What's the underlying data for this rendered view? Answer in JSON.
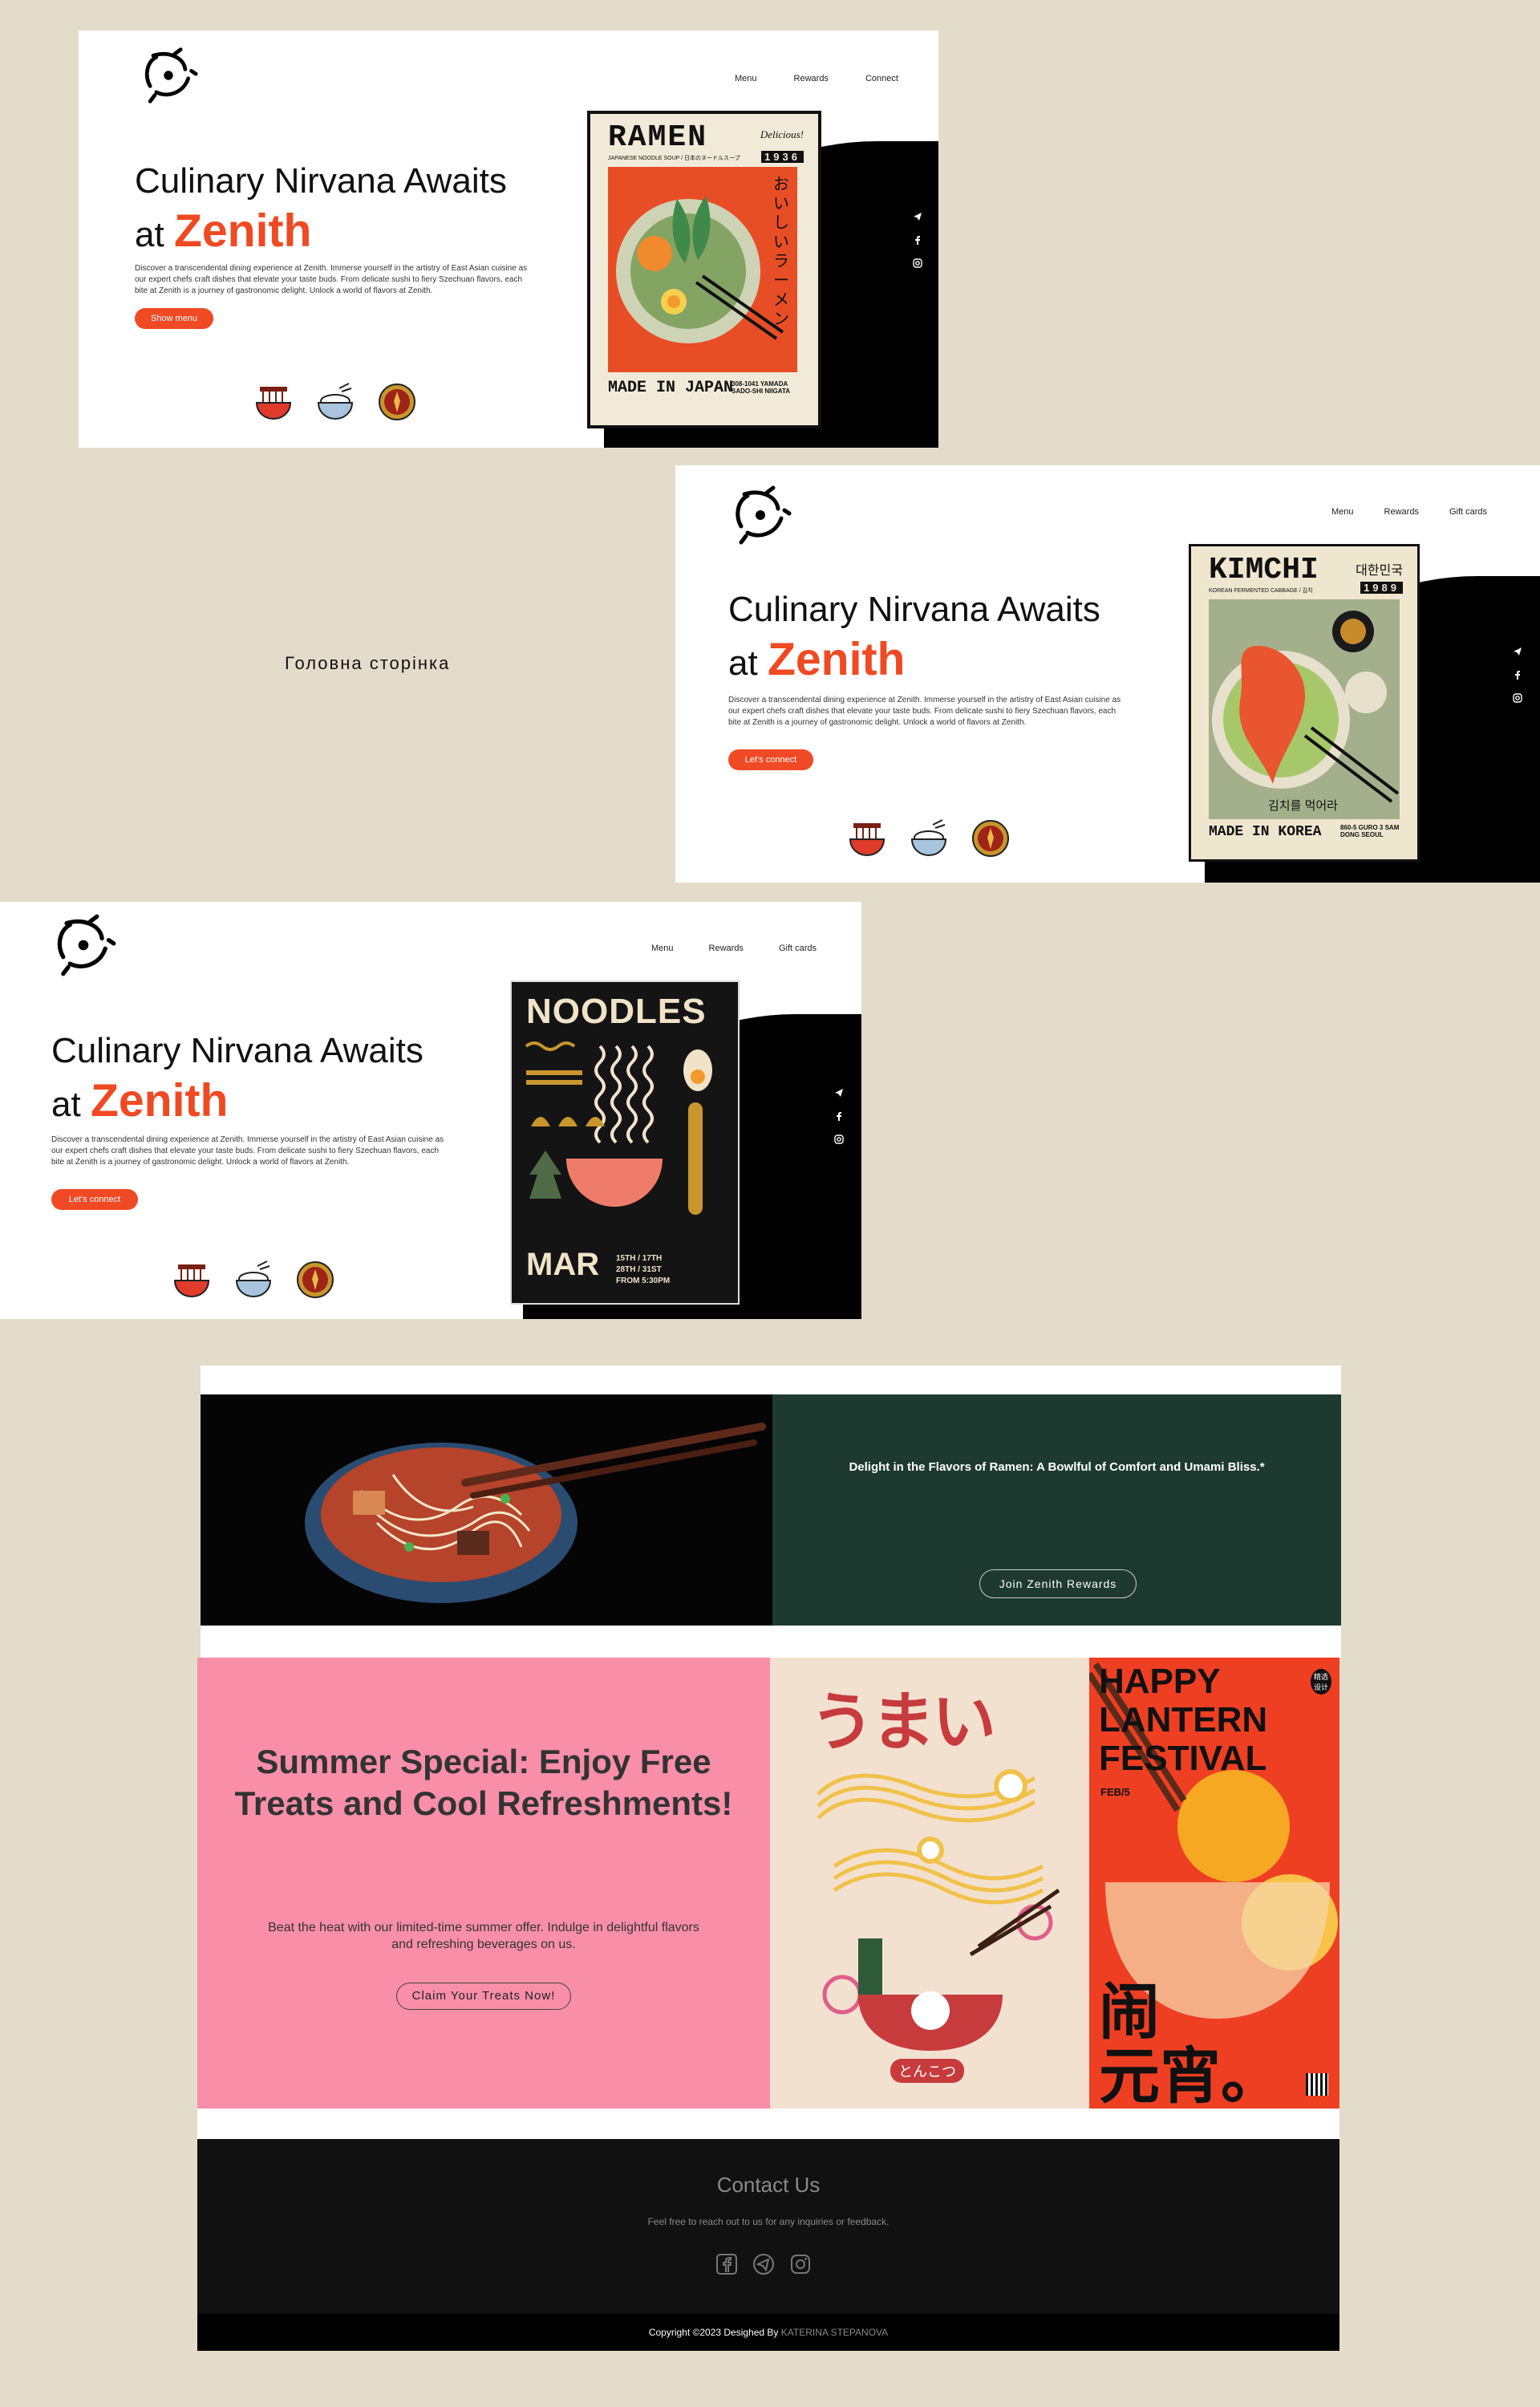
{
  "brand": {
    "name": "Zenith"
  },
  "nav": {
    "menu": "Menu",
    "rewards": "Rewards",
    "connect": "Connect",
    "gift_cards": "Gift cards"
  },
  "hero": {
    "title_line1": "Culinary Nirvana Awaits",
    "title_at": "at",
    "title_brand": "Zenith",
    "description": "Discover a transcendental dining experience at Zenith. Immerse yourself in the artistry of East Asian cuisine as our expert chefs craft dishes that elevate your taste buds. From delicate sushi to fiery Szechuan flavors, each bite at Zenith is a journey of gastronomic delight. Unlock a world of flavors at Zenith.",
    "btn_show_menu": "Show menu",
    "btn_lets_connect": "Let's connect"
  },
  "caption": "Головна сторінка",
  "posters": {
    "ramen": {
      "title": "RAMEN",
      "subtitle": "JAPANESE NOODLE SOUP / 日本のヌードルスープ",
      "year": "1936",
      "script": "Delicious!",
      "jp": "おいしいラーメン",
      "footer": "MADE IN JAPAN",
      "address": "308-1041 YAMADA SADO-SHI NIIGATA"
    },
    "kimchi": {
      "title": "KIMCHI",
      "kr_country": "대한민국",
      "subtitle": "KOREAN FERMENTED CABBAGE / 김치",
      "year": "1989",
      "kr_phrase": "김치를 먹어라",
      "footer": "MADE IN KOREA",
      "address": "860-5 GURO 3 SAM DONG SEOUL"
    },
    "noodles": {
      "title": "NOODLES",
      "month": "MAR",
      "dates": "15TH / 17TH  28TH / 31ST  FROM 5:30PM"
    }
  },
  "ramen_banner": {
    "headline": "Delight in the Flavors of Ramen: A Bowlful of Comfort and Umami Bliss.*",
    "button": "Join Zenith Rewards"
  },
  "summer": {
    "title_line1": "Summer Special: Enjoy Free",
    "title_line2": "Treats and Cool Refreshments!",
    "body_line1": "Beat the heat with our limited-time summer offer. Indulge in delightful flavors",
    "body_line2": "and refreshing beverages on us.",
    "button": "Claim Your Treats Now!"
  },
  "poster_umai": {
    "title": "うまい",
    "label": "とんこつ"
  },
  "poster_lantern": {
    "line1": "HAPPY",
    "line2": "LANTERN",
    "line3": "FESTIVAL",
    "date": "FEB/5",
    "badge": "精选 设计",
    "zh_top": "闹",
    "zh_bottom": "元宵。"
  },
  "contact": {
    "title": "Contact Us",
    "subtitle": "Feel free to reach out to us for any inquiries or feedback."
  },
  "footer": {
    "copyright": "Copyright ©2023  Desighed By",
    "author": "KATERINA STEPANOVA"
  },
  "colors": {
    "accent": "#ef4a23",
    "background": "#e4dcca",
    "ramen_panel": "#1e3a30",
    "summer_pink": "#f88ea8"
  }
}
